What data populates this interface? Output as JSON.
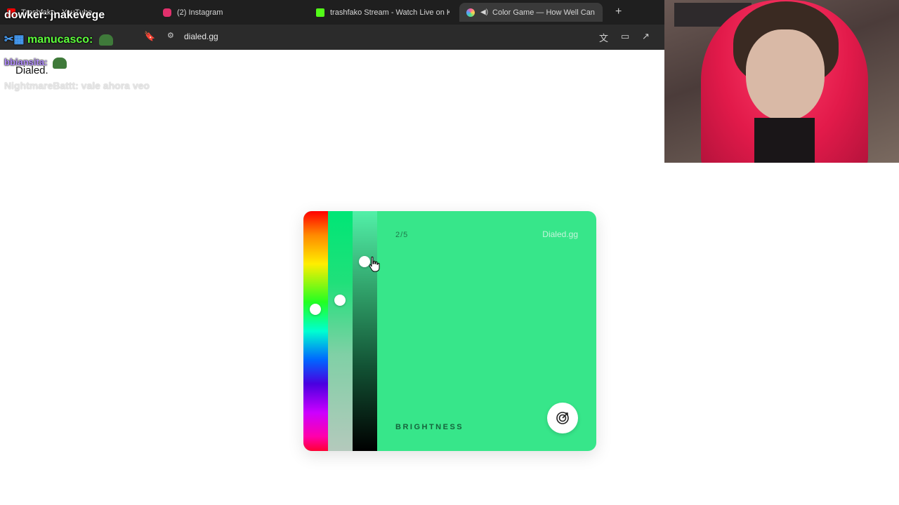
{
  "browser": {
    "tabs": [
      {
        "label": "Trashfako - YouTube",
        "favicon_color": "#ff0000"
      },
      {
        "label": "(2) Instagram",
        "favicon_color": "#e1306c"
      },
      {
        "label": "trashfako Stream - Watch Live on Kick",
        "favicon_color": "#53fc18"
      },
      {
        "label": "Color Game — How Well Can",
        "favicon_color": "#ff5ea0",
        "active": true
      }
    ],
    "close_symbol": "×",
    "new_tab_symbol": "+",
    "url": "dialed.gg"
  },
  "chat": [
    {
      "user": "dowker:",
      "message": "jnakevege",
      "user_color": "#ffffff"
    },
    {
      "user": "manucasco:",
      "message": "",
      "user_color": "#5dff3b",
      "emote": true
    },
    {
      "user": "bbiansita:",
      "message": "",
      "user_color": "#b28cff",
      "emote": true
    },
    {
      "user": "NightmareBattt:",
      "message": "vale ahora veo",
      "user_color": "#dddddd"
    }
  ],
  "page": {
    "logo": "Dialed."
  },
  "game": {
    "round": "2/5",
    "brand": "Dialed.gg",
    "slider_label": "BRIGHTNESS",
    "target_color": "#37e68a",
    "hue_level": 0.41,
    "saturation_level": 0.37,
    "brightness_level": 0.21,
    "submit_icon": "target-icon"
  }
}
